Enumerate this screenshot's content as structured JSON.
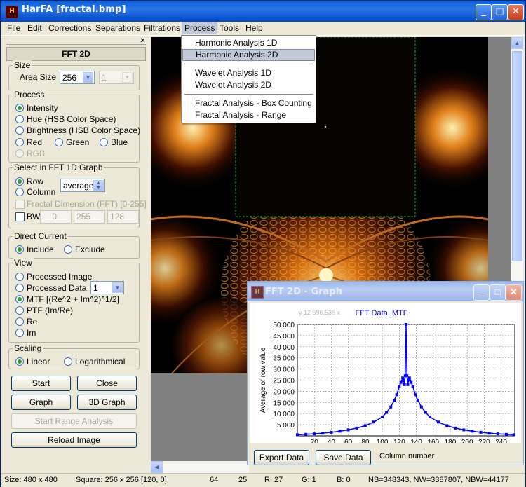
{
  "window": {
    "title": "HarFA [fractal.bmp]",
    "icon_letters": "H",
    "minimize": "_",
    "maximize": "□",
    "close": "✕"
  },
  "menubar": {
    "items": [
      "File",
      "Edit",
      "Corrections",
      "Separations",
      "Filtrations",
      "Process",
      "Tools",
      "Help"
    ],
    "open_item": "Process"
  },
  "process_menu": {
    "items": [
      "Harmonic Analysis 1D",
      "Harmonic Analysis 2D",
      "Wavelet Analysis 1D",
      "Wavelet Analysis 2D",
      "Fractal Analysis - Box Counting",
      "Fractal Analysis - Range"
    ],
    "selected": "Harmonic Analysis 2D"
  },
  "panel": {
    "close_glyph": "✕",
    "title": "FFT 2D",
    "size": {
      "group": "Size",
      "area_size_label": "Area Size",
      "area_size_value": "256",
      "second_value": "1"
    },
    "process": {
      "group": "Process",
      "options": [
        "Intensity",
        "Hue (HSB Color Space)",
        "Brightness (HSB Color Space)"
      ],
      "rgb_options": [
        "Red",
        "Green",
        "Blue"
      ],
      "rgb_label": "RGB",
      "selected": "Intensity"
    },
    "select": {
      "group": "Select in FFT 1D Graph",
      "row": "Row",
      "column": "Column",
      "mode_value": "average",
      "fractal_dim": "Fractal Dimension (FFT) [0-255]",
      "bw_label": "BW",
      "bw_values": [
        "0",
        "255",
        "128"
      ]
    },
    "direct_current": {
      "group": "Direct Current",
      "include": "Include",
      "exclude": "Exclude",
      "selected": "Include"
    },
    "view": {
      "group": "View",
      "options": [
        "Processed Image",
        "Processed Data",
        "MTF [(Re^2 + Im^2)^1/2]",
        "PTF (Im/Re)",
        "Re",
        "Im"
      ],
      "processed_data_value": "1",
      "selected": "MTF [(Re^2 + Im^2)^1/2]"
    },
    "scaling": {
      "group": "Scaling",
      "linear": "Linear",
      "log": "Logarithmical",
      "selected": "Linear"
    },
    "buttons": {
      "start": "Start",
      "close": "Close",
      "graph": "Graph",
      "graph3d": "3D Graph",
      "range": "Start Range Analysis",
      "reload": "Reload Image"
    }
  },
  "graph_window": {
    "title": "FFT 2D - Graph",
    "coord_readout": "y 12 696,536 x",
    "export": "Export Data",
    "save": "Save Data"
  },
  "chart_data": {
    "type": "line",
    "title": "FFT Data, MTF",
    "xlabel": "Column number",
    "ylabel": "Average of row value",
    "xlim": [
      0,
      256
    ],
    "ylim": [
      0,
      50000
    ],
    "yticks": [
      "50 000",
      "45 000",
      "40 000",
      "35 000",
      "30 000",
      "25 000",
      "20 000",
      "15 000",
      "10 000",
      "5 000"
    ],
    "xticks": [
      "20",
      "40",
      "60",
      "80",
      "100",
      "120",
      "140",
      "160",
      "180",
      "200",
      "220",
      "240"
    ],
    "grid": true,
    "series": [
      {
        "color": "#0000ff",
        "x": [
          0,
          10,
          20,
          30,
          40,
          50,
          60,
          70,
          80,
          90,
          100,
          105,
          110,
          114,
          117,
          120,
          122,
          124,
          125,
          126,
          127,
          128,
          129,
          130,
          131,
          132,
          134,
          136,
          139,
          142,
          146,
          151,
          156,
          166,
          176,
          186,
          196,
          206,
          216,
          226,
          236,
          246,
          255
        ],
        "y": [
          500,
          700,
          900,
          1200,
          1600,
          2100,
          2700,
          3500,
          4600,
          6200,
          8500,
          10500,
          13000,
          16000,
          18500,
          22000,
          24000,
          26000,
          25000,
          23000,
          27000,
          50000,
          27000,
          23000,
          25000,
          26000,
          24000,
          22000,
          18500,
          16000,
          13000,
          10500,
          8500,
          6200,
          4600,
          3500,
          2700,
          2100,
          1600,
          1200,
          900,
          700,
          500
        ]
      }
    ]
  },
  "status": {
    "size": "Size: 480 x 480",
    "square": "Square: 256 x 256 [120, 0]",
    "a": "64",
    "b": "25",
    "r": "R: 27",
    "g": "G: 1",
    "bl": "B: 0",
    "counts": "NB=348343, NW=3387807, NBW=44177"
  }
}
